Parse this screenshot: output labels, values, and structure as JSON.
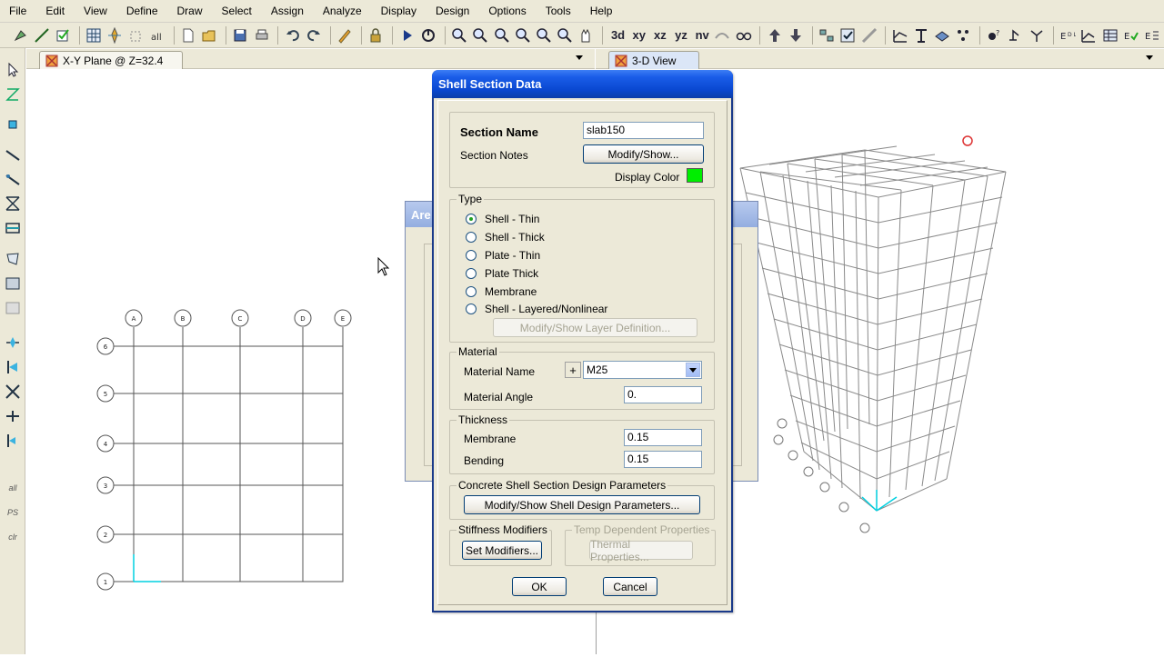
{
  "menu": [
    "File",
    "Edit",
    "View",
    "Define",
    "Draw",
    "Select",
    "Assign",
    "Analyze",
    "Display",
    "Design",
    "Options",
    "Tools",
    "Help"
  ],
  "toolbar": {
    "xy_label": "xy",
    "xz_label": "xz",
    "yz_label": "yz",
    "nv_label": "nv",
    "threed_label": "3d"
  },
  "left_toolbar": {
    "all_label": "all",
    "ps_label": "PS",
    "clr_label": "clr"
  },
  "tabs": {
    "plan": "X-Y Plane @ Z=32.4",
    "view3d": "3-D View"
  },
  "plan_grid": {
    "x_labels": [
      "A",
      "B",
      "C",
      "D",
      "E"
    ],
    "y_labels": [
      "6",
      "5",
      "4",
      "3",
      "2",
      "1"
    ]
  },
  "background_dialog": {
    "title_fragment": "Are"
  },
  "dialog": {
    "title": "Shell Section Data",
    "section_name_label": "Section Name",
    "section_name_value": "slab150",
    "section_notes_label": "Section Notes",
    "modify_show_label": "Modify/Show...",
    "display_color_label": "Display Color",
    "display_color": "#00ee00",
    "type_legend": "Type",
    "type_options": [
      {
        "label": "Shell - Thin",
        "checked": true
      },
      {
        "label": "Shell - Thick",
        "checked": false
      },
      {
        "label": "Plate - Thin",
        "checked": false
      },
      {
        "label": "Plate Thick",
        "checked": false
      },
      {
        "label": "Membrane",
        "checked": false
      },
      {
        "label": "Shell - Layered/Nonlinear",
        "checked": false
      }
    ],
    "layer_def_button": "Modify/Show Layer Definition...",
    "material_legend": "Material",
    "material_name_label": "Material Name",
    "material_plus": "+",
    "material_name_value": "M25",
    "material_angle_label": "Material Angle",
    "material_angle_value": "0.",
    "thickness_legend": "Thickness",
    "membrane_label": "Membrane",
    "membrane_value": "0.15",
    "bending_label": "Bending",
    "bending_value": "0.15",
    "concrete_legend": "Concrete Shell Section Design Parameters",
    "concrete_button": "Modify/Show Shell Design Parameters...",
    "stiffness_legend": "Stiffness Modifiers",
    "set_modifiers_button": "Set Modifiers...",
    "temp_legend": "Temp Dependent Properties",
    "thermal_button": "Thermal Properties...",
    "ok_button": "OK",
    "cancel_button": "Cancel"
  },
  "colors": {
    "title_bar": "#0a48d1",
    "dialog_bg": "#ece9d8",
    "grid_line": "#555555",
    "axis": "#00d0e0"
  }
}
